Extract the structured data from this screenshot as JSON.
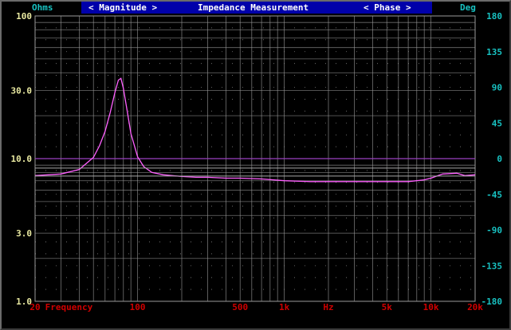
{
  "header": {
    "left_unit": "Ohms",
    "right_unit": "Deg",
    "magnitude_tab": "< Magnitude >",
    "title": "Impedance Measurement",
    "phase_tab": "< Phase >"
  },
  "colors": {
    "background": "#000000",
    "header_bar": "#0000aa",
    "left_axis_text": "#e8e8a0",
    "right_axis_text": "#18c2c2",
    "x_axis_text": "#d00000",
    "grid": "#9a9a9a",
    "magnitude_trace": "#ff60ff",
    "phase_trace": "#a8a8a8",
    "zero_phase_line": "#9a40c0"
  },
  "chart_data": {
    "type": "line",
    "xscale": "log",
    "xlim": [
      20,
      20000
    ],
    "xlabel": "Frequency",
    "xunit_label": "Hz",
    "x_ticks": [
      {
        "value": 20,
        "label": "20"
      },
      {
        "value": 100,
        "label": "100"
      },
      {
        "value": 500,
        "label": "500"
      },
      {
        "value": 1000,
        "label": "1k"
      },
      {
        "value": 5000,
        "label": "5k"
      },
      {
        "value": 10000,
        "label": "10k"
      },
      {
        "value": 20000,
        "label": "20k"
      }
    ],
    "y_left": {
      "scale": "log",
      "ylim": [
        1,
        100
      ],
      "unit": "Ohms",
      "ticks": [
        {
          "value": 100,
          "label": "100"
        },
        {
          "value": 30,
          "label": "30.0"
        },
        {
          "value": 10,
          "label": "10.0"
        },
        {
          "value": 3,
          "label": "3.0"
        },
        {
          "value": 1,
          "label": "1.0"
        }
      ]
    },
    "y_right": {
      "scale": "linear",
      "ylim": [
        -180,
        180
      ],
      "unit": "Deg",
      "ticks": [
        {
          "value": 180,
          "label": "180"
        },
        {
          "value": 135,
          "label": "135"
        },
        {
          "value": 90,
          "label": "90"
        },
        {
          "value": 45,
          "label": "45"
        },
        {
          "value": 0,
          "label": "0"
        },
        {
          "value": -45,
          "label": "-45"
        },
        {
          "value": -90,
          "label": "-90"
        },
        {
          "value": -135,
          "label": "-135"
        },
        {
          "value": -180,
          "label": "-180"
        }
      ]
    },
    "grid": true,
    "series": [
      {
        "axis": "left",
        "color": "#ff60ff",
        "points": [
          [
            20,
            7.6
          ],
          [
            30,
            7.8
          ],
          [
            40,
            8.4
          ],
          [
            50,
            10.2
          ],
          [
            55,
            12.3
          ],
          [
            60,
            15.5
          ],
          [
            65,
            21.0
          ],
          [
            70,
            29.0
          ],
          [
            74,
            35.5
          ],
          [
            77,
            36.5
          ],
          [
            80,
            31.0
          ],
          [
            85,
            21.5
          ],
          [
            90,
            15.0
          ],
          [
            100,
            10.3
          ],
          [
            110,
            8.8
          ],
          [
            125,
            8.0
          ],
          [
            150,
            7.7
          ],
          [
            200,
            7.5
          ],
          [
            250,
            7.4
          ],
          [
            300,
            7.4
          ],
          [
            400,
            7.3
          ],
          [
            500,
            7.3
          ],
          [
            700,
            7.2
          ],
          [
            1000,
            7.0
          ],
          [
            1500,
            6.9
          ],
          [
            2000,
            6.9
          ],
          [
            3000,
            6.9
          ],
          [
            5000,
            6.9
          ],
          [
            7000,
            6.9
          ],
          [
            9000,
            7.1
          ],
          [
            10000,
            7.3
          ],
          [
            12000,
            7.8
          ],
          [
            15000,
            7.9
          ],
          [
            17000,
            7.6
          ],
          [
            20000,
            7.7
          ]
        ]
      },
      {
        "axis": "right",
        "color": "#a8a8a8",
        "points": [
          [
            20,
            -12
          ],
          [
            100,
            -12
          ],
          [
            1000,
            -12
          ],
          [
            10000,
            -12
          ],
          [
            20000,
            -12
          ]
        ]
      },
      {
        "axis": "right",
        "color": "#a8a8a8",
        "points": [
          [
            20,
            -22
          ],
          [
            100,
            -22
          ],
          [
            1000,
            -22
          ],
          [
            10000,
            -22
          ],
          [
            20000,
            -22
          ]
        ]
      }
    ]
  }
}
